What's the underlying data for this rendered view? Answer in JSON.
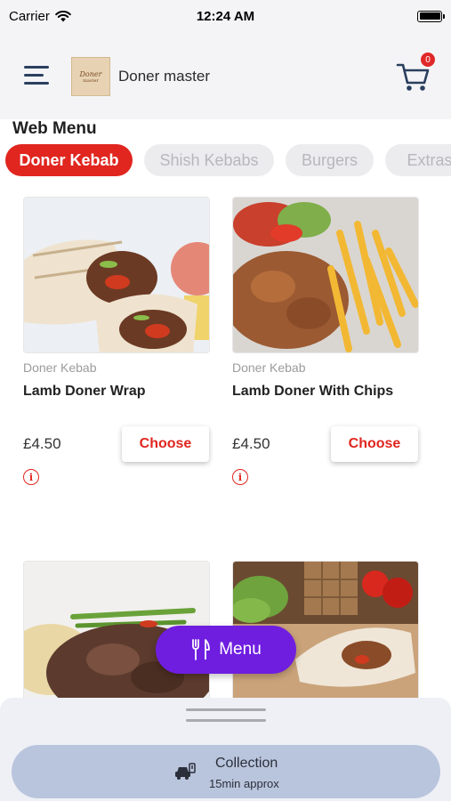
{
  "status_bar": {
    "carrier": "Carrier",
    "time": "12:24 AM"
  },
  "header": {
    "logo_line1": "Doner",
    "logo_line2": "master",
    "brand_name": "Doner master",
    "cart_count": "0"
  },
  "section_title": "Web Menu",
  "tabs": [
    {
      "label": "Doner Kebab",
      "active": true
    },
    {
      "label": "Shish Kebabs",
      "active": false
    },
    {
      "label": "Burgers",
      "active": false
    },
    {
      "label": "Extras",
      "active": false
    }
  ],
  "products": [
    {
      "category": "Doner Kebab",
      "name": "Lamb Doner Wrap",
      "price": "£4.50",
      "button": "Choose",
      "info": "i",
      "image": "doner-wrap-photo"
    },
    {
      "category": "Doner Kebab",
      "name": "Lamb Doner With Chips",
      "price": "£4.50",
      "button": "Choose",
      "info": "i",
      "image": "doner-with-chips-photo"
    },
    {
      "category": "",
      "name": "",
      "price": "",
      "button": "",
      "image": "doner-plate-photo"
    },
    {
      "category": "",
      "name": "",
      "price": "",
      "button": "",
      "image": "wrap-on-board-photo"
    }
  ],
  "menu_button": {
    "label": "Menu",
    "icon": "fork-knife-icon"
  },
  "bottom_sheet": {
    "mode": "Collection",
    "time": "15min approx",
    "icon": "car-icon"
  },
  "colors": {
    "accent": "#e0261f",
    "menu_purple": "#6f1ee0",
    "collection_bg": "#b9c5dc"
  }
}
